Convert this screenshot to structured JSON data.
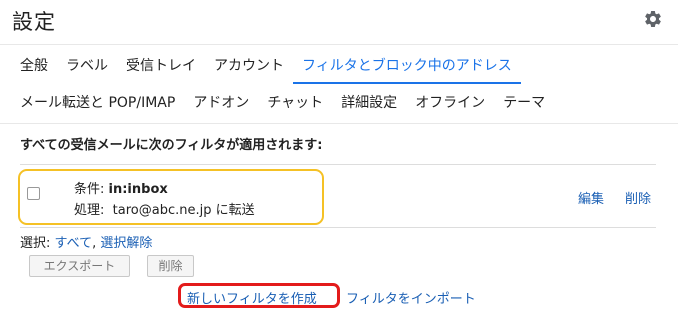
{
  "page": {
    "title": "設定"
  },
  "header": {
    "settings_icon": "gear-icon"
  },
  "tabs": {
    "row1": [
      {
        "label": "全般"
      },
      {
        "label": "ラベル"
      },
      {
        "label": "受信トレイ"
      },
      {
        "label": "アカウント"
      },
      {
        "label": "フィルタとブロック中のアドレス",
        "active": true
      }
    ],
    "row2": [
      {
        "label": "メール転送と POP/IMAP"
      },
      {
        "label": "アドオン"
      },
      {
        "label": "チャット"
      },
      {
        "label": "詳細設定"
      },
      {
        "label": "オフライン"
      },
      {
        "label": "テーマ"
      }
    ]
  },
  "filters": {
    "heading": "すべての受信メールに次のフィルタが適用されます:",
    "items": [
      {
        "criteria_label": "条件: ",
        "criteria_value": "in:inbox",
        "action_label": "処理:",
        "action_value": "taro@abc.ne.jp に転送",
        "edit_label": "編集",
        "delete_label": "削除",
        "highlight_color": "#f5c125"
      }
    ],
    "select_label": "選択: ",
    "select_all": "すべて",
    "select_separator": ", ",
    "select_none": "選択解除",
    "export_button": "エクスポート",
    "delete_button": "削除",
    "create_filter": "新しいフィルタを作成",
    "create_highlight_color": "#e31b1b",
    "import_filters": "フィルタをインポート"
  },
  "colors": {
    "accent": "#1a73e8",
    "link": "#1a5fb4"
  }
}
